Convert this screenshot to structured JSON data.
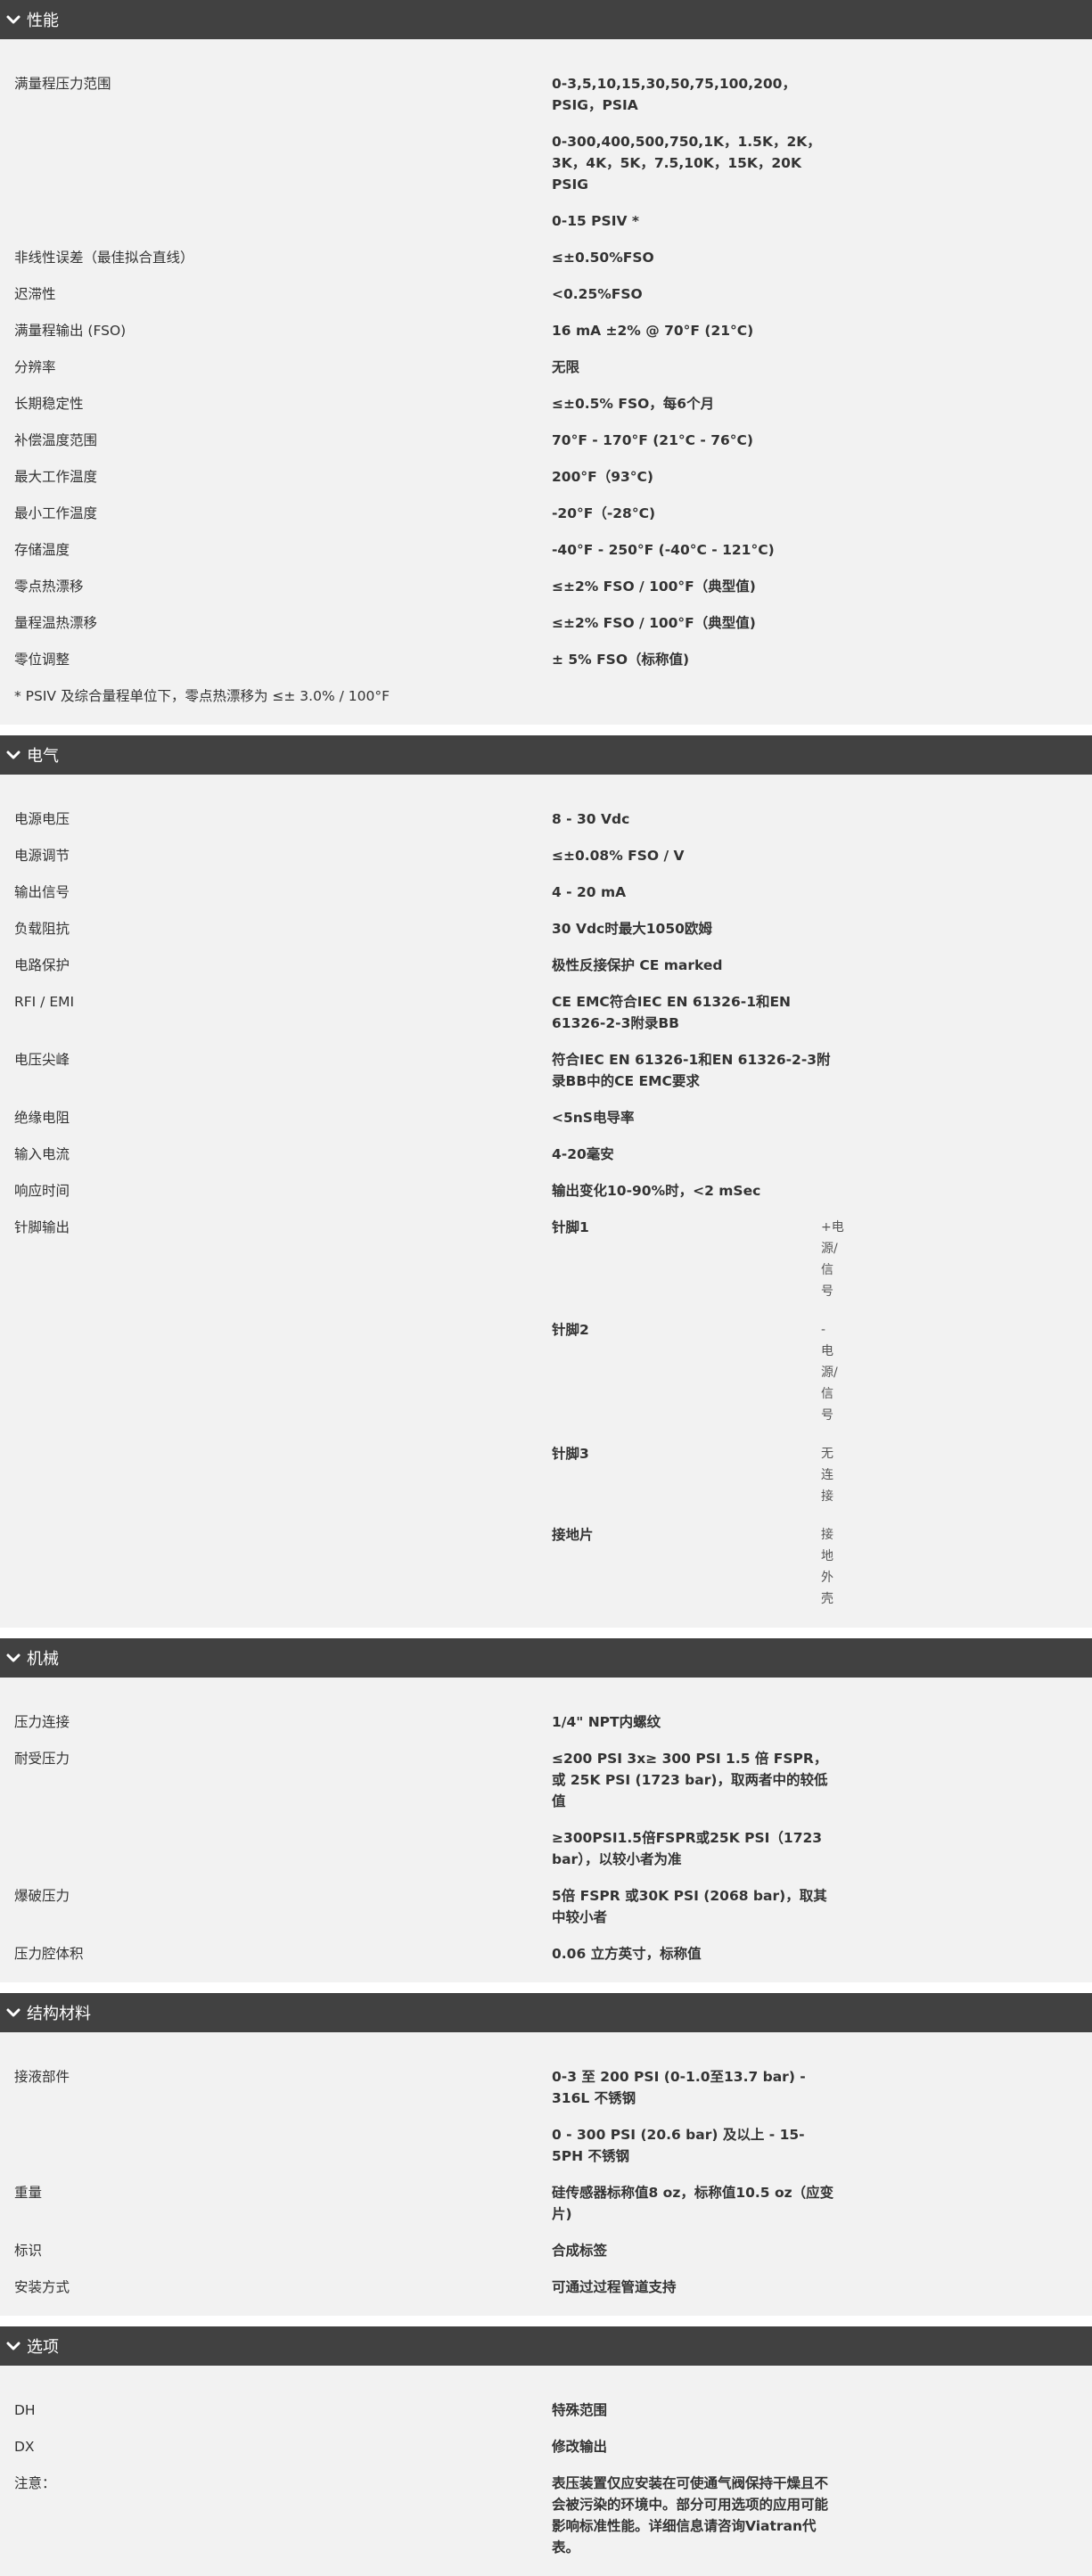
{
  "sections": [
    {
      "title": "性能",
      "rows": [
        {
          "label": "满量程压力范围",
          "values": [
            "0-3,5,10,15,30,50,75,100,200，PSIG，PSIA",
            "0-300,400,500,750,1K，1.5K，2K，3K，4K，5K，7.5,10K，15K，20K PSIG",
            "0-15 PSIV *"
          ]
        },
        {
          "label": "非线性误差（最佳拟合直线）",
          "values": [
            "≤±0.50%FSO"
          ]
        },
        {
          "label": "迟滞性",
          "values": [
            "<0.25%FSO"
          ]
        },
        {
          "label": "满量程输出 (FSO)",
          "values": [
            "16 mA ±2% @ 70°F (21°C)"
          ]
        },
        {
          "label": "分辨率",
          "values": [
            "无限"
          ]
        },
        {
          "label": "长期稳定性",
          "values": [
            "≤±0.5% FSO，每6个月"
          ]
        },
        {
          "label": "补偿温度范围",
          "values": [
            "70°F - 170°F (21°C - 76°C)"
          ]
        },
        {
          "label": "最大工作温度",
          "values": [
            "200°F（93°C)"
          ]
        },
        {
          "label": "最小工作温度",
          "values": [
            "-20°F（-28°C)"
          ]
        },
        {
          "label": "存储温度",
          "values": [
            "-40°F - 250°F (-40°C - 121°C)"
          ]
        },
        {
          "label": "零点热漂移",
          "values": [
            "≤±2% FSO / 100°F（典型值)"
          ]
        },
        {
          "label": "量程温热漂移",
          "values": [
            "≤±2% FSO / 100°F（典型值)"
          ]
        },
        {
          "label": "零位调整",
          "values": [
            "± 5%  FSO（标称值)"
          ]
        }
      ],
      "note": "* PSIV 及综合量程单位下，零点热漂移为 ≤± 3.0% / 100°F"
    },
    {
      "title": "电气",
      "rows": [
        {
          "label": "电源电压",
          "values": [
            "8 - 30 Vdc"
          ]
        },
        {
          "label": "电源调节",
          "values": [
            "≤±0.08% FSO / V"
          ]
        },
        {
          "label": "输出信号",
          "values": [
            "4 - 20 mA"
          ]
        },
        {
          "label": "负载阻抗",
          "values": [
            "30 Vdc时最大1050欧姆"
          ]
        },
        {
          "label": "电路保护",
          "values": [
            "极性反接保护 CE marked"
          ]
        },
        {
          "label": "RFI / EMI",
          "values": [
            "CE EMC符合IEC EN 61326-1和EN 61326-2-3附录BB"
          ]
        },
        {
          "label": "电压尖峰",
          "values": [
            "符合IEC EN 61326-1和EN 61326-2-3附录BB中的CE EMC要求"
          ]
        },
        {
          "label": "绝缘电阻",
          "values": [
            "<5nS电导率"
          ]
        },
        {
          "label": "输入电流",
          "values": [
            "4-20毫安"
          ]
        },
        {
          "label": "响应时间",
          "values": [
            "输出变化10-90%时，<2 mSec"
          ]
        },
        {
          "label": "针脚输出",
          "values": [],
          "pins": [
            {
              "name": "针脚1",
              "desc": "+电源/信号"
            },
            {
              "name": "针脚2",
              "desc": "- 电源/信号"
            },
            {
              "name": "针脚3",
              "desc": "无连接"
            },
            {
              "name": "接地片",
              "desc": "接地外壳"
            }
          ]
        }
      ]
    },
    {
      "title": "机械",
      "rows": [
        {
          "label": "压力连接",
          "values": [
            "1/4\"  NPT内螺纹"
          ]
        },
        {
          "label": "耐受压力",
          "values": [
            "≤200 PSI 3x≥ 300 PSI 1.5 倍 FSPR，或 25K PSI (1723 bar)，取两者中的较低值",
            "≥300PSI1.5倍FSPR或25K PSI（1723 bar），以较小者为准"
          ]
        },
        {
          "label": "爆破压力",
          "values": [
            "5倍 FSPR 或30K PSI (2068 bar)，取其中较小者"
          ]
        },
        {
          "label": "压力腔体积",
          "values": [
            "0.06 立方英寸，标称值"
          ]
        }
      ]
    },
    {
      "title": "结构材料",
      "rows": [
        {
          "label": "接液部件",
          "values": [
            "0-3 至 200 PSI (0-1.0至13.7 bar) - 316L 不锈钢",
            "0 - 300 PSI (20.6 bar) 及以上 - 15-5PH 不锈钢"
          ]
        },
        {
          "label": "重量",
          "values": [
            "硅传感器标称值8 oz，标称值10.5 oz（应变片)"
          ]
        },
        {
          "label": "标识",
          "values": [
            "合成标签"
          ]
        },
        {
          "label": "安装方式",
          "values": [
            "可通过过程管道支持"
          ]
        }
      ]
    },
    {
      "title": "选项",
      "rows": [
        {
          "label": "DH",
          "values": [
            "特殊范围"
          ]
        },
        {
          "label": "DX",
          "values": [
            "修改输出"
          ]
        },
        {
          "label": "注意：",
          "values": [
            "表压装置仅应安装在可使通气阀保持干燥且不会被污染的环境中。部分可用选项的应用可能影响标准性能。详细信息请咨询Viatran代表。"
          ]
        }
      ]
    }
  ],
  "icons": {
    "section_toggle": "chevron-down-icon"
  },
  "colors": {
    "header_bg": "#414141",
    "body_bg": "#f2f2f2",
    "header_text": "#ffffff"
  }
}
